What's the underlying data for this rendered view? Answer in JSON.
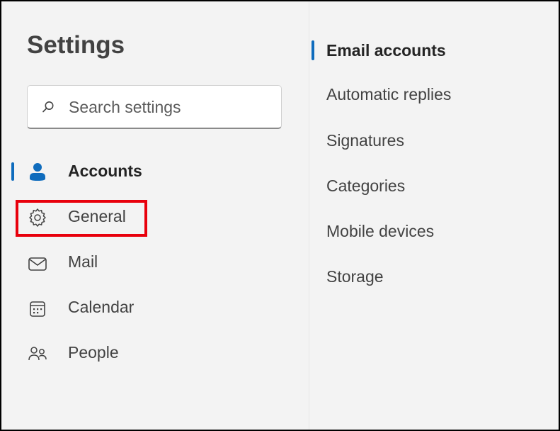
{
  "settings": {
    "title": "Settings",
    "search": {
      "placeholder": "Search settings",
      "value": ""
    },
    "nav": [
      {
        "label": "Accounts",
        "icon": "person-icon",
        "active": true
      },
      {
        "label": "General",
        "icon": "gear-icon",
        "active": false
      },
      {
        "label": "Mail",
        "icon": "mail-icon",
        "active": false
      },
      {
        "label": "Calendar",
        "icon": "calendar-icon",
        "active": false
      },
      {
        "label": "People",
        "icon": "people-icon",
        "active": false
      }
    ],
    "sub_nav": [
      {
        "label": "Email accounts",
        "active": true
      },
      {
        "label": "Automatic replies",
        "active": false
      },
      {
        "label": "Signatures",
        "active": false
      },
      {
        "label": "Categories",
        "active": false
      },
      {
        "label": "Mobile devices",
        "active": false
      },
      {
        "label": "Storage",
        "active": false
      }
    ]
  },
  "colors": {
    "accent": "#0f6cbd",
    "highlight": "#e8000c",
    "background": "#f3f3f3"
  }
}
